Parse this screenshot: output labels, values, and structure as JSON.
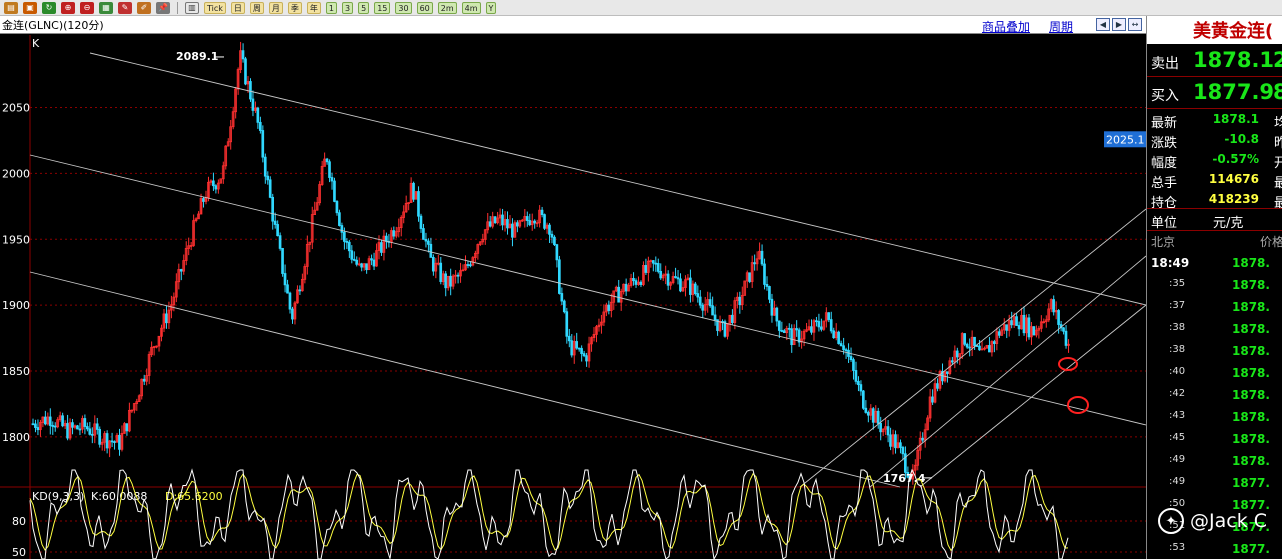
{
  "toolbar": {
    "icon_buttons": [
      {
        "name": "file-icon",
        "color": "#c07a20"
      },
      {
        "name": "open-folder-icon",
        "color": "#c85a00"
      },
      {
        "name": "refresh-icon",
        "color": "#2a8a2a"
      },
      {
        "name": "zoom-in-icon",
        "color": "#c02020"
      },
      {
        "name": "zoom-out-icon",
        "color": "#c02020"
      },
      {
        "name": "grid-icon",
        "color": "#3a8a3a"
      },
      {
        "name": "pen-icon",
        "color": "#c03030"
      },
      {
        "name": "brush-icon",
        "color": "#c07020"
      },
      {
        "name": "pin-icon",
        "color": "#777777"
      }
    ],
    "text_buttons": [
      "Tick",
      "日",
      "周",
      "月",
      "季",
      "年"
    ],
    "period_buttons": [
      "1",
      "3",
      "5",
      "15",
      "30",
      "60",
      "2m",
      "4m",
      "Y"
    ]
  },
  "chart_header": {
    "title": "金连(GLNC)(120分)",
    "link_overlay": "商品叠加",
    "link_period": "周期"
  },
  "chart": {
    "k_label": "K",
    "y_ticks": [
      "2050",
      "2000",
      "1950",
      "1900",
      "1850",
      "1800"
    ],
    "annotation_high": "2089.1",
    "annotation_low": "1767.4",
    "price_tag": "2025.1",
    "kd_label": "KD(9,3,3)",
    "k_text": "K:60.0088",
    "d_text": "D:65.6200",
    "kd_y_ticks": [
      "80",
      "50"
    ],
    "colors": {
      "up": "#ff3030",
      "down": "#30d8ff",
      "kd_k": "#ffffff",
      "kd_d": "#ffff40",
      "grid": "#8b0000",
      "channel": "#c8c8c8",
      "marker": "#ff2020"
    }
  },
  "chart_data": {
    "type": "candlestick",
    "title": "金连(GLNC)(120分)",
    "ylim": [
      1762,
      2105
    ],
    "y_ticks": [
      2050,
      2000,
      1950,
      1900,
      1850,
      1800
    ],
    "annotations": [
      {
        "label": "2089.1",
        "value": 2089.1
      },
      {
        "label": "1767.4",
        "value": 1767.4
      },
      {
        "label": "2025.1",
        "value": 2025.1
      }
    ],
    "trend_path": [
      1810,
      1815,
      1805,
      1808,
      1800,
      1795,
      1830,
      1870,
      1900,
      1945,
      1985,
      2000,
      2089.1,
      2040,
      1960,
      1890,
      1950,
      2015,
      1950,
      1925,
      1940,
      1960,
      1990,
      1935,
      1915,
      1925,
      1955,
      1965,
      1955,
      1970,
      1960,
      1870,
      1860,
      1895,
      1910,
      1920,
      1930,
      1920,
      1915,
      1900,
      1880,
      1905,
      1940,
      1890,
      1875,
      1880,
      1890,
      1870,
      1830,
      1810,
      1795,
      1767.4,
      1830,
      1855,
      1875,
      1860,
      1880,
      1890,
      1880,
      1900,
      1870
    ],
    "kd_series": {
      "name": "KD(9,3,3)",
      "K": 60.0088,
      "D": 65.62
    }
  },
  "quote_panel": {
    "title": "美黄金连(",
    "sell_label": "卖出",
    "sell_price": "1878.1",
    "sell_extra": "2",
    "buy_label": "买入",
    "buy_price": "1877.9",
    "buy_extra": "8",
    "stats": [
      {
        "label": "最新",
        "value": "1878.1",
        "suffix": "均"
      },
      {
        "label": "涨跌",
        "value": "-10.8",
        "suffix": "昨"
      },
      {
        "label": "幅度",
        "value": "-0.57%",
        "suffix": "开"
      },
      {
        "label": "总手",
        "value": "114676",
        "suffix": "最"
      },
      {
        "label": "持仓",
        "value": "418239",
        "suffix": "最"
      }
    ],
    "unit_label": "单位",
    "unit_value": "元/克",
    "tick_header_left": "北京",
    "tick_header_right": "价格",
    "ticks": [
      {
        "time": "18:49",
        "price": "1878."
      },
      {
        "time": ":35",
        "price": "1878."
      },
      {
        "time": ":37",
        "price": "1878."
      },
      {
        "time": ":38",
        "price": "1878."
      },
      {
        "time": ":38",
        "price": "1878."
      },
      {
        "time": ":40",
        "price": "1878."
      },
      {
        "time": ":42",
        "price": "1878."
      },
      {
        "time": ":43",
        "price": "1878."
      },
      {
        "time": ":45",
        "price": "1878."
      },
      {
        "time": ":49",
        "price": "1878."
      },
      {
        "time": ":49",
        "price": "1877."
      },
      {
        "time": ":50",
        "price": "1877."
      },
      {
        "time": ":51",
        "price": "1877."
      },
      {
        "time": ":53",
        "price": "1877."
      }
    ]
  },
  "watermark": {
    "text": "@Jack C"
  }
}
